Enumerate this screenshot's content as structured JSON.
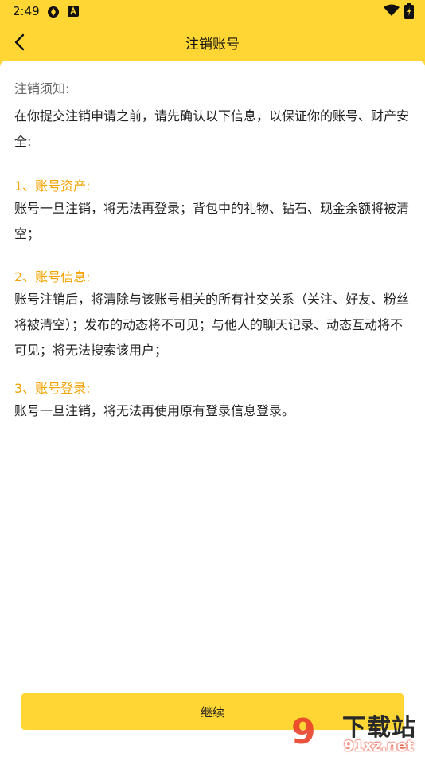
{
  "status_bar": {
    "time": "2:49"
  },
  "header": {
    "title": "注销账号"
  },
  "notice": {
    "title": "注销须知:",
    "intro": "在你提交注销申请之前，请先确认以下信息，以保证你的账号、财产安全:"
  },
  "sections": [
    {
      "title": "1、账号资产:",
      "body": "账号一旦注销，将无法再登录；背包中的礼物、钻石、现金余额将被清空；"
    },
    {
      "title": "2、账号信息:",
      "body": "账号注销后，将清除与该账号相关的所有社交关系（关注、好友、粉丝将被清空）；发布的动态将不可见；与他人的聊天记录、动态互动将不可见；将无法搜索该用户；"
    },
    {
      "title": "3、账号登录:",
      "body": "账号一旦注销，将无法再使用原有登录信息登录。"
    }
  ],
  "footer": {
    "continue_label": "继续"
  },
  "watermark": {
    "logo": "9",
    "text": "下载站",
    "url": "91xz.net"
  },
  "colors": {
    "brand_yellow": "#ffd633",
    "section_orange": "#f5a300"
  }
}
